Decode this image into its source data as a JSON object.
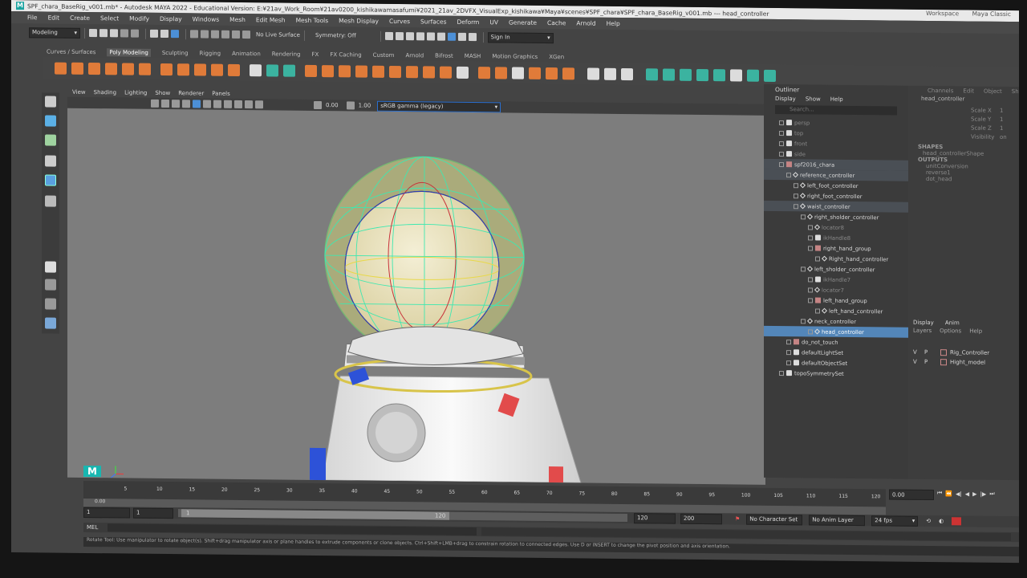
{
  "window": {
    "title": "SPF_chara_BaseRig_v001.mb* - Autodesk MAYA 2022 - Educational Version: E:¥21av_Work_Room¥21av0200_kishikawamasafumi¥2021_21av_2DVFX_VisualExp_kishikawa¥Maya¥scenes¥SPF_chara¥SPF_chara_BaseRig_v001.mb --- head_controller",
    "workspace_label": "Workspace",
    "workspace_value": "Maya Classic"
  },
  "menubar": [
    "File",
    "Edit",
    "Create",
    "Select",
    "Modify",
    "Display",
    "Windows",
    "Mesh",
    "Edit Mesh",
    "Mesh Tools",
    "Mesh Display",
    "Curves",
    "Surfaces",
    "Deform",
    "UV",
    "Generate",
    "Cache",
    "Arnold",
    "Help"
  ],
  "statusline": {
    "menu_set": "Modeling",
    "live_surface": "No Live Surface",
    "symmetry": "Symmetry: Off",
    "sign_in": "Sign In"
  },
  "shelf_tabs": [
    "Curves / Surfaces",
    "Poly Modeling",
    "Sculpting",
    "Rigging",
    "Animation",
    "Rendering",
    "FX",
    "FX Caching",
    "Custom",
    "Arnold",
    "Bifrost",
    "MASH",
    "Motion Graphics",
    "XGen"
  ],
  "shelf_active": "Poly Modeling",
  "viewport": {
    "menu": [
      "View",
      "Shading",
      "Lighting",
      "Show",
      "Renderer",
      "Panels"
    ],
    "exposure": "0.00",
    "gamma": "1.00",
    "color_space": "sRGB gamma (legacy)"
  },
  "outliner": {
    "title": "Outliner",
    "menu": [
      "Display",
      "Show",
      "Help"
    ],
    "search_placeholder": "Search...",
    "items": [
      {
        "label": "persp",
        "indent": 1,
        "icon": "camera",
        "dim": true
      },
      {
        "label": "top",
        "indent": 1,
        "icon": "camera",
        "dim": true
      },
      {
        "label": "front",
        "indent": 1,
        "icon": "camera",
        "dim": true
      },
      {
        "label": "side",
        "indent": 1,
        "icon": "camera",
        "dim": true
      },
      {
        "label": "spf2016_chara",
        "indent": 1,
        "icon": "group",
        "hl": true
      },
      {
        "label": "reference_controller",
        "indent": 2,
        "icon": "curve",
        "hl": true
      },
      {
        "label": "left_foot_controller",
        "indent": 3,
        "icon": "curve"
      },
      {
        "label": "right_foot_controller",
        "indent": 3,
        "icon": "curve"
      },
      {
        "label": "waist_controller",
        "indent": 3,
        "icon": "curve",
        "hl": true
      },
      {
        "label": "right_sholder_controller",
        "indent": 4,
        "icon": "curve"
      },
      {
        "label": "locator8",
        "indent": 5,
        "icon": "locator",
        "dim": true
      },
      {
        "label": "ikHandle8",
        "indent": 5,
        "icon": "ik",
        "dim": true
      },
      {
        "label": "right_hand_group",
        "indent": 5,
        "icon": "group"
      },
      {
        "label": "Right_hand_controller",
        "indent": 6,
        "icon": "curve"
      },
      {
        "label": "left_sholder_controller",
        "indent": 4,
        "icon": "curve"
      },
      {
        "label": "ikHandle7",
        "indent": 5,
        "icon": "ik",
        "dim": true
      },
      {
        "label": "locator7",
        "indent": 5,
        "icon": "locator",
        "dim": true
      },
      {
        "label": "left_hand_group",
        "indent": 5,
        "icon": "group"
      },
      {
        "label": "left_hand_controller",
        "indent": 6,
        "icon": "curve"
      },
      {
        "label": "neck_controller",
        "indent": 4,
        "icon": "curve"
      },
      {
        "label": "head_controller",
        "indent": 5,
        "icon": "curve",
        "sel": true
      },
      {
        "label": "do_not_touch",
        "indent": 2,
        "icon": "group"
      },
      {
        "label": "defaultLightSet",
        "indent": 2,
        "icon": "set"
      },
      {
        "label": "defaultObjectSet",
        "indent": 2,
        "icon": "set"
      },
      {
        "label": "topoSymmetrySet",
        "indent": 1,
        "icon": "set"
      }
    ]
  },
  "channelbox": {
    "menu": [
      "Channels",
      "Edit",
      "Object",
      "Show"
    ],
    "node": "head_controller",
    "attributes": [
      {
        "name": "Scale X",
        "value": "1"
      },
      {
        "name": "Scale Y",
        "value": "1"
      },
      {
        "name": "Scale Z",
        "value": "1"
      },
      {
        "name": "Visibility",
        "value": "on"
      }
    ],
    "shapes_header": "SHAPES",
    "shape": "head_controllerShape",
    "outputs_header": "OUTPUTS",
    "outputs": [
      "unitConversion",
      "reverse1",
      "dot_head"
    ],
    "layer_tabs": [
      "Display",
      "Anim"
    ],
    "layer_menu": [
      "Layers",
      "Options",
      "Help"
    ],
    "layers": [
      {
        "v": "V",
        "p": "P",
        "name": "Rig_Controller"
      },
      {
        "v": "V",
        "p": "P",
        "name": "Hight_model"
      }
    ]
  },
  "timeline": {
    "ticks": [
      "5",
      "10",
      "15",
      "20",
      "25",
      "30",
      "35",
      "40",
      "45",
      "50",
      "55",
      "60",
      "65",
      "70",
      "75",
      "80",
      "85",
      "90",
      "95",
      "100",
      "105",
      "110",
      "115",
      "120"
    ],
    "current_frame": "0.00",
    "range_start": "1",
    "range_start_inner": "1",
    "playback_start": "1",
    "slider_end": "120",
    "range_end": "120",
    "range_end_total": "200",
    "char_set": "No Character Set",
    "anim_layer": "No Anim Layer",
    "fps": "24 fps"
  },
  "mel_label": "MEL",
  "help_line": "Rotate Tool: Use manipulator to rotate object(s). Shift+drag manipulator axis or plane handles to extrude components or clone objects. Ctrl+Shift+LMB+drag to constrain rotation to connected edges. Use D or INSERT to change the pivot position and axis orientation."
}
